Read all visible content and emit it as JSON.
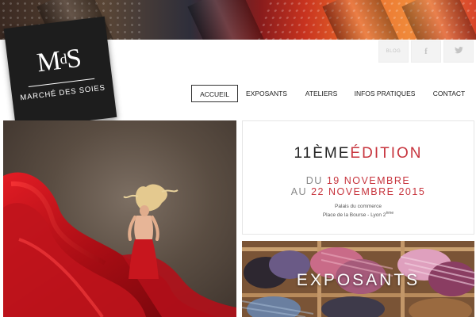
{
  "logo": {
    "mark_m": "M",
    "mark_d": "d",
    "mark_s": "S",
    "name": "MARCHÉ DES SOIES"
  },
  "social": {
    "blog_label": "BLOG",
    "facebook_glyph": "f",
    "twitter_glyph": "t"
  },
  "nav": {
    "items": [
      "ACCUEIL",
      "EXPOSANTS",
      "ATELIERS",
      "INFOS PRATIQUES",
      "CONTACT"
    ],
    "active": "ACCUEIL"
  },
  "edition": {
    "title_part1": "11ÈME",
    "title_part2": "ÉDITION",
    "line1_prefix": "DU",
    "line1_date": "19 NOVEMBRE",
    "line2_prefix": "AU",
    "line2_date": "22 NOVEMBRE 2015",
    "venue_line1": "Palais du commerce",
    "venue_line2": "Place de la Bourse - Lyon 2",
    "venue_sup": "ème"
  },
  "exposants": {
    "label": "EXPOSANTS"
  },
  "colors": {
    "accent_red": "#c7343d",
    "logo_bg": "#1d1d1d",
    "dress_red": "#c0141c"
  },
  "icons": [
    "facebook-icon",
    "twitter-icon"
  ]
}
